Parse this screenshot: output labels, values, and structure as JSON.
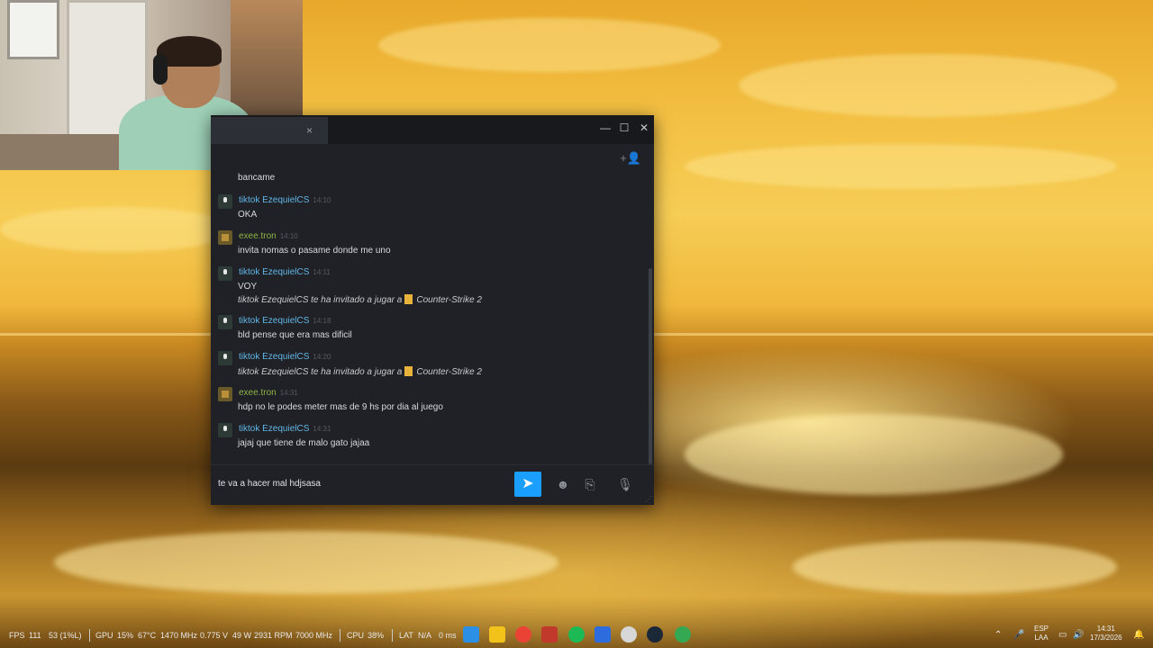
{
  "chat": {
    "tab_close": "×",
    "window": {
      "minimize": "—",
      "maximize": "☐",
      "close": "✕"
    },
    "add_friend_icon": "+👤",
    "messages": [
      {
        "text": "bancame"
      },
      {
        "author": "tiktok EzequielCS",
        "time": "14:10",
        "lines": [
          "OKA"
        ]
      },
      {
        "author": "exee.tron",
        "time": "14:10",
        "lines": [
          "invita nomas o pasame donde me uno"
        ]
      },
      {
        "author": "tiktok EzequielCS",
        "time": "14:11",
        "lines": [
          "VOY"
        ],
        "invite": {
          "prefix": "tiktok EzequielCS te ha invitado a jugar a",
          "game": "Counter-Strike 2"
        }
      },
      {
        "author": "tiktok EzequielCS",
        "time": "14:18",
        "lines": [
          "bld pense que era mas dificil"
        ]
      },
      {
        "author": "tiktok EzequielCS",
        "time": "14:20",
        "invite": {
          "prefix": "tiktok EzequielCS te ha invitado a jugar a",
          "game": "Counter-Strike 2"
        }
      },
      {
        "author": "exee.tron",
        "time": "14:31",
        "lines": [
          "hdp no le podes meter mas de 9 hs por dia al juego"
        ]
      },
      {
        "author": "tiktok EzequielCS",
        "time": "14:31",
        "lines": [
          "jajaj que tiene de malo gato jajaa"
        ]
      }
    ],
    "input_value": "te va a hacer mal hdjsasa",
    "send_icon": "➤",
    "emoji_icon": "☻",
    "attach_icon": "⎘",
    "voice_icon": "🎙"
  },
  "taskbar": {
    "fps_label": "FPS",
    "fps": "111",
    "fps_low": "53 (1%L)",
    "gpu_label": "GPU",
    "gpu_load": "15%",
    "gpu_temp": "67°C",
    "gpu_clock": "1470 MHz",
    "gpu_volt": "0.775 V",
    "gpu_power": "49 W",
    "gpu_fan": "2931 RPM",
    "mem_clock": "7000 MHz",
    "cpu_label": "CPU",
    "cpu_load": "38%",
    "lat_label": "LAT",
    "lat_value": "N/A",
    "lat_ms": "0 ms",
    "lang_top": "ESP",
    "lang_bottom": "LAA",
    "time": "14:31",
    "date": "17/3/2026",
    "icon_colors": [
      "#2b8fe6",
      "#f2c21b",
      "#ea4335",
      "#c0392b",
      "#1db954",
      "#2d6cdf",
      "#d7d7d7",
      "#1b2838",
      "#34a853"
    ]
  }
}
